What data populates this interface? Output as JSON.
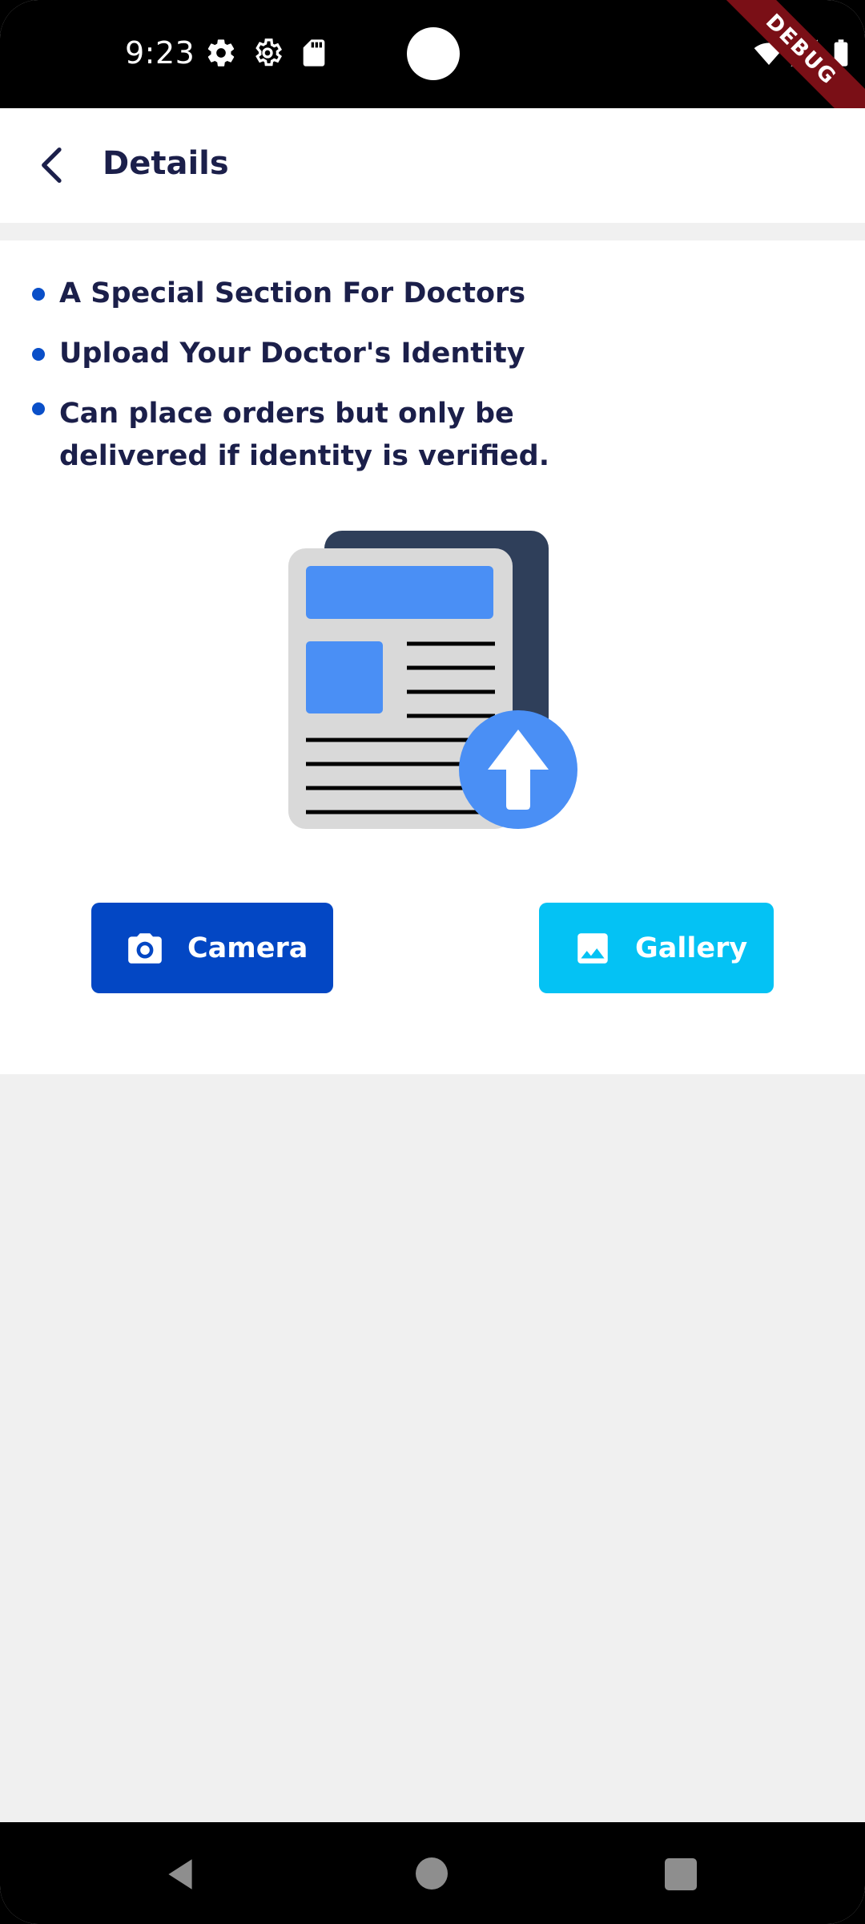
{
  "status_bar": {
    "time": "9:23",
    "icons": [
      "settings-gear-icon",
      "settings-outline-icon",
      "sd-card-icon",
      "wifi-icon",
      "signal-icon",
      "battery-icon"
    ],
    "debug_label": "DEBUG"
  },
  "app_bar": {
    "title": "Details",
    "back_icon": "chevron-left-icon"
  },
  "bullets": [
    "A Special Section For Doctors",
    "Upload Your Doctor's Identity",
    "Can place orders but only be delivered if identity is verified."
  ],
  "illustration": {
    "icon": "document-upload-icon"
  },
  "buttons": {
    "camera_label": "Camera",
    "camera_icon": "camera-icon",
    "gallery_label": "Gallery",
    "gallery_icon": "image-icon"
  },
  "colors": {
    "primary_dark": "#0347c4",
    "accent_cyan": "#04c2f4",
    "title_text": "#1b1f4a",
    "bullet_dot": "#0a4fc8",
    "background": "#f0f0f0",
    "illustration_blue": "#4a8ff5",
    "illustration_navy": "#2f3f5a"
  },
  "nav_bar": {
    "back": "nav-back-icon",
    "home": "nav-home-icon",
    "recents": "nav-recents-icon"
  }
}
